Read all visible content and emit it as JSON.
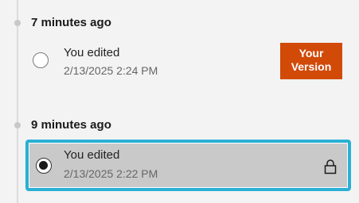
{
  "groups": [
    {
      "header": "7 minutes ago",
      "versions": [
        {
          "title": "You edited",
          "date": "2/13/2025 2:24 PM",
          "selected": false,
          "badge": {
            "line1": "Your",
            "line2": "Version"
          }
        }
      ]
    },
    {
      "header": "9 minutes ago",
      "versions": [
        {
          "title": "You edited",
          "date": "2/13/2025 2:22 PM",
          "selected": true,
          "icon": "lock-icon"
        }
      ]
    }
  ],
  "colors": {
    "badge": "#d14a08",
    "selection_border": "#2ab0d4",
    "selected_background": "#c9c9c9"
  }
}
